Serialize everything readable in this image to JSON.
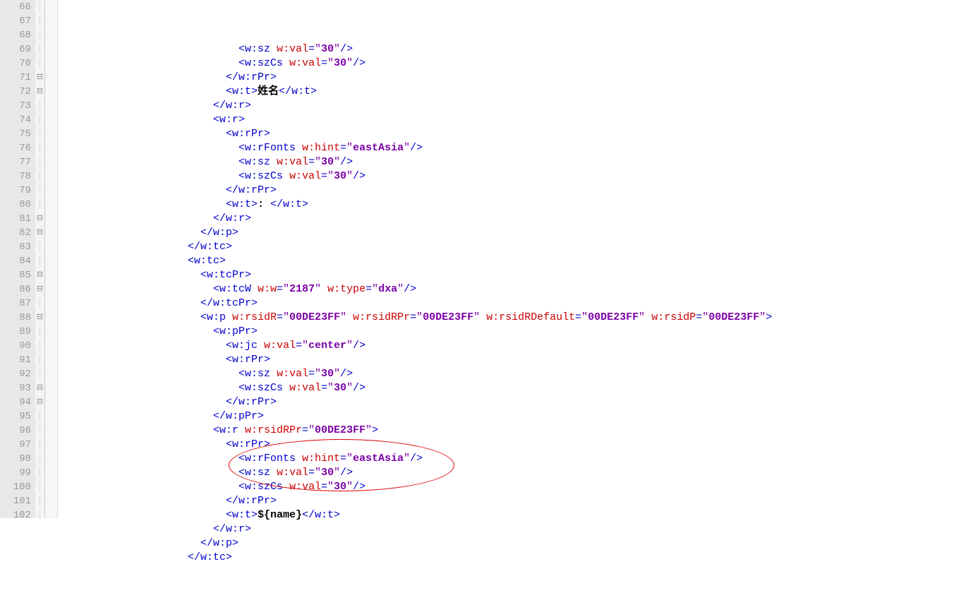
{
  "editor": {
    "startLine": 66,
    "endLine": 102,
    "foldMarks": {
      "71": "⊟",
      "72": "⊟",
      "81": "⊟",
      "82": "⊟",
      "85": "⊟",
      "86": "⊟",
      "88": "⊟",
      "93": "⊟",
      "94": "⊟"
    },
    "lines": [
      {
        "n": 66,
        "indent": 14,
        "tokens": [
          {
            "t": "tag",
            "v": "<w:sz "
          },
          {
            "t": "attr",
            "v": "w:val"
          },
          {
            "t": "tag",
            "v": "="
          },
          {
            "t": "val",
            "v": "\""
          },
          {
            "t": "valb",
            "v": "30"
          },
          {
            "t": "val",
            "v": "\""
          },
          {
            "t": "tag",
            "v": "/>"
          }
        ]
      },
      {
        "n": 67,
        "indent": 14,
        "tokens": [
          {
            "t": "tag",
            "v": "<w:szCs "
          },
          {
            "t": "attr",
            "v": "w:val"
          },
          {
            "t": "tag",
            "v": "="
          },
          {
            "t": "val",
            "v": "\""
          },
          {
            "t": "valb",
            "v": "30"
          },
          {
            "t": "val",
            "v": "\""
          },
          {
            "t": "tag",
            "v": "/>"
          }
        ]
      },
      {
        "n": 68,
        "indent": 13,
        "tokens": [
          {
            "t": "tag",
            "v": "</w:rPr>"
          }
        ]
      },
      {
        "n": 69,
        "indent": 13,
        "tokens": [
          {
            "t": "tag",
            "v": "<w:t>"
          },
          {
            "t": "txt",
            "v": "姓名"
          },
          {
            "t": "tag",
            "v": "</w:t>"
          }
        ]
      },
      {
        "n": 70,
        "indent": 12,
        "tokens": [
          {
            "t": "tag",
            "v": "</w:r>"
          }
        ]
      },
      {
        "n": 71,
        "indent": 12,
        "tokens": [
          {
            "t": "tag",
            "v": "<w:r>"
          }
        ]
      },
      {
        "n": 72,
        "indent": 13,
        "tokens": [
          {
            "t": "tag",
            "v": "<w:rPr>"
          }
        ]
      },
      {
        "n": 73,
        "indent": 14,
        "tokens": [
          {
            "t": "tag",
            "v": "<w:rFonts "
          },
          {
            "t": "attr",
            "v": "w:hint"
          },
          {
            "t": "tag",
            "v": "="
          },
          {
            "t": "val",
            "v": "\""
          },
          {
            "t": "valb",
            "v": "eastAsia"
          },
          {
            "t": "val",
            "v": "\""
          },
          {
            "t": "tag",
            "v": "/>"
          }
        ]
      },
      {
        "n": 74,
        "indent": 14,
        "tokens": [
          {
            "t": "tag",
            "v": "<w:sz "
          },
          {
            "t": "attr",
            "v": "w:val"
          },
          {
            "t": "tag",
            "v": "="
          },
          {
            "t": "val",
            "v": "\""
          },
          {
            "t": "valb",
            "v": "30"
          },
          {
            "t": "val",
            "v": "\""
          },
          {
            "t": "tag",
            "v": "/>"
          }
        ]
      },
      {
        "n": 75,
        "indent": 14,
        "tokens": [
          {
            "t": "tag",
            "v": "<w:szCs "
          },
          {
            "t": "attr",
            "v": "w:val"
          },
          {
            "t": "tag",
            "v": "="
          },
          {
            "t": "val",
            "v": "\""
          },
          {
            "t": "valb",
            "v": "30"
          },
          {
            "t": "val",
            "v": "\""
          },
          {
            "t": "tag",
            "v": "/>"
          }
        ]
      },
      {
        "n": 76,
        "indent": 13,
        "tokens": [
          {
            "t": "tag",
            "v": "</w:rPr>"
          }
        ]
      },
      {
        "n": 77,
        "indent": 13,
        "tokens": [
          {
            "t": "tag",
            "v": "<w:t>"
          },
          {
            "t": "txt",
            "v": ": "
          },
          {
            "t": "tag",
            "v": "</w:t>"
          }
        ]
      },
      {
        "n": 78,
        "indent": 12,
        "tokens": [
          {
            "t": "tag",
            "v": "</w:r>"
          }
        ]
      },
      {
        "n": 79,
        "indent": 11,
        "tokens": [
          {
            "t": "tag",
            "v": "</w:p>"
          }
        ]
      },
      {
        "n": 80,
        "indent": 10,
        "tokens": [
          {
            "t": "tag",
            "v": "</w:tc>"
          }
        ]
      },
      {
        "n": 81,
        "indent": 10,
        "tokens": [
          {
            "t": "tag",
            "v": "<w:tc>"
          }
        ]
      },
      {
        "n": 82,
        "indent": 11,
        "tokens": [
          {
            "t": "tag",
            "v": "<w:tcPr>"
          }
        ]
      },
      {
        "n": 83,
        "indent": 12,
        "tokens": [
          {
            "t": "tag",
            "v": "<w:tcW "
          },
          {
            "t": "attr",
            "v": "w:w"
          },
          {
            "t": "tag",
            "v": "="
          },
          {
            "t": "val",
            "v": "\""
          },
          {
            "t": "valb",
            "v": "2187"
          },
          {
            "t": "val",
            "v": "\" "
          },
          {
            "t": "attr",
            "v": "w:type"
          },
          {
            "t": "tag",
            "v": "="
          },
          {
            "t": "val",
            "v": "\""
          },
          {
            "t": "valb",
            "v": "dxa"
          },
          {
            "t": "val",
            "v": "\""
          },
          {
            "t": "tag",
            "v": "/>"
          }
        ]
      },
      {
        "n": 84,
        "indent": 11,
        "tokens": [
          {
            "t": "tag",
            "v": "</w:tcPr>"
          }
        ]
      },
      {
        "n": 85,
        "indent": 11,
        "tokens": [
          {
            "t": "tag",
            "v": "<w:p "
          },
          {
            "t": "attr",
            "v": "w:rsidR"
          },
          {
            "t": "tag",
            "v": "="
          },
          {
            "t": "val",
            "v": "\""
          },
          {
            "t": "valb",
            "v": "00DE23FF"
          },
          {
            "t": "val",
            "v": "\" "
          },
          {
            "t": "attr",
            "v": "w:rsidRPr"
          },
          {
            "t": "tag",
            "v": "="
          },
          {
            "t": "val",
            "v": "\""
          },
          {
            "t": "valb",
            "v": "00DE23FF"
          },
          {
            "t": "val",
            "v": "\" "
          },
          {
            "t": "attr",
            "v": "w:rsidRDefault"
          },
          {
            "t": "tag",
            "v": "="
          },
          {
            "t": "val",
            "v": "\""
          },
          {
            "t": "valb",
            "v": "00DE23FF"
          },
          {
            "t": "val",
            "v": "\" "
          },
          {
            "t": "attr",
            "v": "w:rsidP"
          },
          {
            "t": "tag",
            "v": "="
          },
          {
            "t": "val",
            "v": "\""
          },
          {
            "t": "valb",
            "v": "00DE23FF"
          },
          {
            "t": "val",
            "v": "\""
          },
          {
            "t": "tag",
            "v": ">"
          }
        ]
      },
      {
        "n": 86,
        "indent": 12,
        "tokens": [
          {
            "t": "tag",
            "v": "<w:pPr>"
          }
        ]
      },
      {
        "n": 87,
        "indent": 13,
        "tokens": [
          {
            "t": "tag",
            "v": "<w:jc "
          },
          {
            "t": "attr",
            "v": "w:val"
          },
          {
            "t": "tag",
            "v": "="
          },
          {
            "t": "val",
            "v": "\""
          },
          {
            "t": "valb",
            "v": "center"
          },
          {
            "t": "val",
            "v": "\""
          },
          {
            "t": "tag",
            "v": "/>"
          }
        ]
      },
      {
        "n": 88,
        "indent": 13,
        "tokens": [
          {
            "t": "tag",
            "v": "<w:rPr>"
          }
        ]
      },
      {
        "n": 89,
        "indent": 14,
        "tokens": [
          {
            "t": "tag",
            "v": "<w:sz "
          },
          {
            "t": "attr",
            "v": "w:val"
          },
          {
            "t": "tag",
            "v": "="
          },
          {
            "t": "val",
            "v": "\""
          },
          {
            "t": "valb",
            "v": "30"
          },
          {
            "t": "val",
            "v": "\""
          },
          {
            "t": "tag",
            "v": "/>"
          }
        ]
      },
      {
        "n": 90,
        "indent": 14,
        "tokens": [
          {
            "t": "tag",
            "v": "<w:szCs "
          },
          {
            "t": "attr",
            "v": "w:val"
          },
          {
            "t": "tag",
            "v": "="
          },
          {
            "t": "val",
            "v": "\""
          },
          {
            "t": "valb",
            "v": "30"
          },
          {
            "t": "val",
            "v": "\""
          },
          {
            "t": "tag",
            "v": "/>"
          }
        ]
      },
      {
        "n": 91,
        "indent": 13,
        "tokens": [
          {
            "t": "tag",
            "v": "</w:rPr>"
          }
        ]
      },
      {
        "n": 92,
        "indent": 12,
        "tokens": [
          {
            "t": "tag",
            "v": "</w:pPr>"
          }
        ]
      },
      {
        "n": 93,
        "indent": 12,
        "tokens": [
          {
            "t": "tag",
            "v": "<w:r "
          },
          {
            "t": "attr",
            "v": "w:rsidRPr"
          },
          {
            "t": "tag",
            "v": "="
          },
          {
            "t": "val",
            "v": "\""
          },
          {
            "t": "valb",
            "v": "00DE23FF"
          },
          {
            "t": "val",
            "v": "\""
          },
          {
            "t": "tag",
            "v": ">"
          }
        ]
      },
      {
        "n": 94,
        "indent": 13,
        "tokens": [
          {
            "t": "tag",
            "v": "<w:rPr>"
          }
        ]
      },
      {
        "n": 95,
        "indent": 14,
        "tokens": [
          {
            "t": "tag",
            "v": "<w:rFonts "
          },
          {
            "t": "attr",
            "v": "w:hint"
          },
          {
            "t": "tag",
            "v": "="
          },
          {
            "t": "val",
            "v": "\""
          },
          {
            "t": "valb",
            "v": "eastAsia"
          },
          {
            "t": "val",
            "v": "\""
          },
          {
            "t": "tag",
            "v": "/>"
          }
        ]
      },
      {
        "n": 96,
        "indent": 14,
        "tokens": [
          {
            "t": "tag",
            "v": "<w:sz "
          },
          {
            "t": "attr",
            "v": "w:val"
          },
          {
            "t": "tag",
            "v": "="
          },
          {
            "t": "val",
            "v": "\""
          },
          {
            "t": "valb",
            "v": "30"
          },
          {
            "t": "val",
            "v": "\""
          },
          {
            "t": "tag",
            "v": "/>"
          }
        ]
      },
      {
        "n": 97,
        "indent": 14,
        "tokens": [
          {
            "t": "tag",
            "v": "<w:szCs "
          },
          {
            "t": "attr",
            "v": "w:val"
          },
          {
            "t": "tag",
            "v": "="
          },
          {
            "t": "val",
            "v": "\""
          },
          {
            "t": "valb",
            "v": "30"
          },
          {
            "t": "val",
            "v": "\""
          },
          {
            "t": "tag",
            "v": "/>"
          }
        ]
      },
      {
        "n": 98,
        "indent": 13,
        "tokens": [
          {
            "t": "tag",
            "v": "</w:rPr>"
          }
        ]
      },
      {
        "n": 99,
        "indent": 13,
        "tokens": [
          {
            "t": "tag",
            "v": "<w:t>"
          },
          {
            "t": "txt",
            "v": "${name}"
          },
          {
            "t": "tag",
            "v": "</w:t>"
          }
        ]
      },
      {
        "n": 100,
        "indent": 12,
        "tokens": [
          {
            "t": "tag",
            "v": "</w:r>"
          }
        ]
      },
      {
        "n": 101,
        "indent": 11,
        "tokens": [
          {
            "t": "tag",
            "v": "</w:p>"
          }
        ]
      },
      {
        "n": 102,
        "indent": 10,
        "tokens": [
          {
            "t": "tag",
            "v": "</w:tc>"
          }
        ]
      }
    ]
  }
}
